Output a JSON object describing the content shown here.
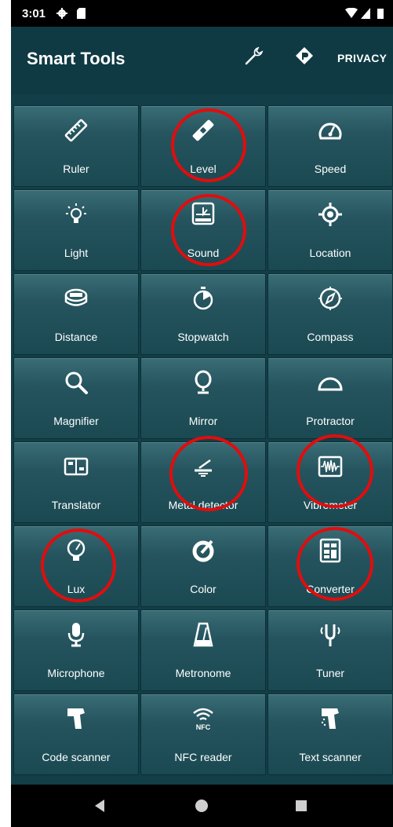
{
  "status": {
    "time": "3:01"
  },
  "appbar": {
    "title": "Smart Tools",
    "privacy_label": "PRIVACY"
  },
  "tools": [
    {
      "label": "Ruler",
      "icon": "ruler-icon"
    },
    {
      "label": "Level",
      "icon": "level-icon"
    },
    {
      "label": "Speed",
      "icon": "speedometer-icon"
    },
    {
      "label": "Light",
      "icon": "lightbulb-icon"
    },
    {
      "label": "Sound",
      "icon": "sound-meter-icon"
    },
    {
      "label": "Location",
      "icon": "location-icon"
    },
    {
      "label": "Distance",
      "icon": "tape-measure-icon"
    },
    {
      "label": "Stopwatch",
      "icon": "stopwatch-icon"
    },
    {
      "label": "Compass",
      "icon": "compass-icon"
    },
    {
      "label": "Magnifier",
      "icon": "magnifier-icon"
    },
    {
      "label": "Mirror",
      "icon": "mirror-icon"
    },
    {
      "label": "Protractor",
      "icon": "protractor-icon"
    },
    {
      "label": "Translator",
      "icon": "translator-icon"
    },
    {
      "label": "Metal detector",
      "icon": "metal-detector-icon"
    },
    {
      "label": "Vibrometer",
      "icon": "vibrometer-icon"
    },
    {
      "label": "Lux",
      "icon": "lux-icon"
    },
    {
      "label": "Color",
      "icon": "color-icon"
    },
    {
      "label": "Converter",
      "icon": "converter-icon"
    },
    {
      "label": "Microphone",
      "icon": "microphone-icon"
    },
    {
      "label": "Metronome",
      "icon": "metronome-icon"
    },
    {
      "label": "Tuner",
      "icon": "tuning-fork-icon"
    },
    {
      "label": "Code scanner",
      "icon": "code-scanner-icon"
    },
    {
      "label": "NFC reader",
      "icon": "nfc-icon"
    },
    {
      "label": "Text scanner",
      "icon": "text-scanner-icon"
    }
  ],
  "nfc_icon_text": "NFC",
  "highlight_color": "#e10d0d"
}
